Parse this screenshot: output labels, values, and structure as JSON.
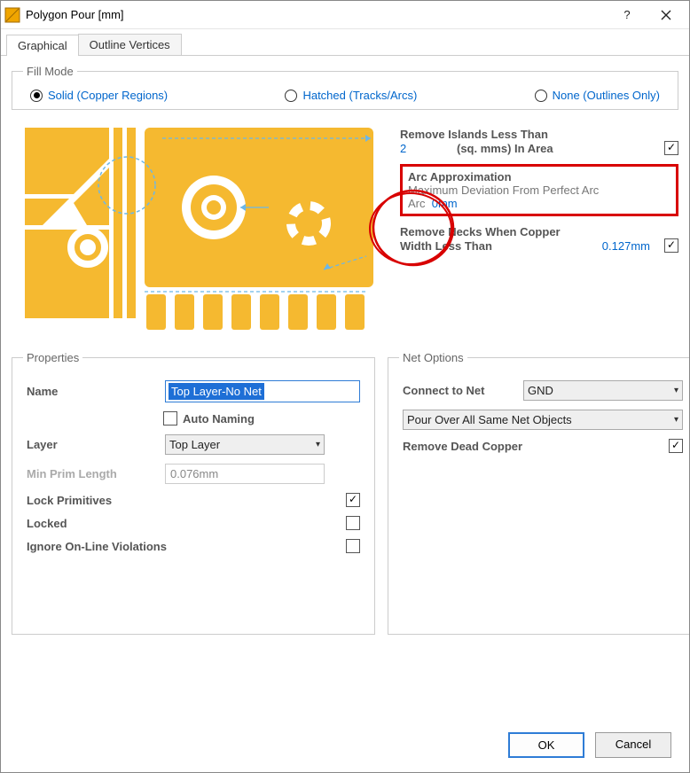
{
  "window": {
    "title": "Polygon Pour [mm]"
  },
  "tabs": {
    "graphical": "Graphical",
    "outline": "Outline Vertices"
  },
  "fillmode": {
    "legend": "Fill Mode",
    "solid": "Solid (Copper Regions)",
    "hatched": "Hatched (Tracks/Arcs)",
    "none": "None (Outlines Only)"
  },
  "side": {
    "islands_head": "Remove Islands Less Than",
    "islands_val": "2",
    "islands_unit": "(sq. mms) In Area",
    "arc_head": "Arc Approximation",
    "arc_sub": "Maximum Deviation From Perfect Arc",
    "arc_val": "0mm",
    "necks_head1": "Remove Necks When Copper",
    "necks_head2": "Width Less Than",
    "necks_val": "0.127mm"
  },
  "props": {
    "legend": "Properties",
    "name_label": "Name",
    "name_value": "Top Layer-No Net",
    "auto_naming": "Auto Naming",
    "layer_label": "Layer",
    "layer_value": "Top Layer",
    "minprim_label": "Min Prim Length",
    "minprim_value": "0.076mm",
    "lock_prim": "Lock Primitives",
    "locked": "Locked",
    "ignore": "Ignore On-Line Violations"
  },
  "net": {
    "legend": "Net Options",
    "connect_label": "Connect to Net",
    "connect_value": "GND",
    "pour_value": "Pour Over All Same Net Objects",
    "remove_dead": "Remove Dead Copper"
  },
  "buttons": {
    "ok": "OK",
    "cancel": "Cancel"
  }
}
